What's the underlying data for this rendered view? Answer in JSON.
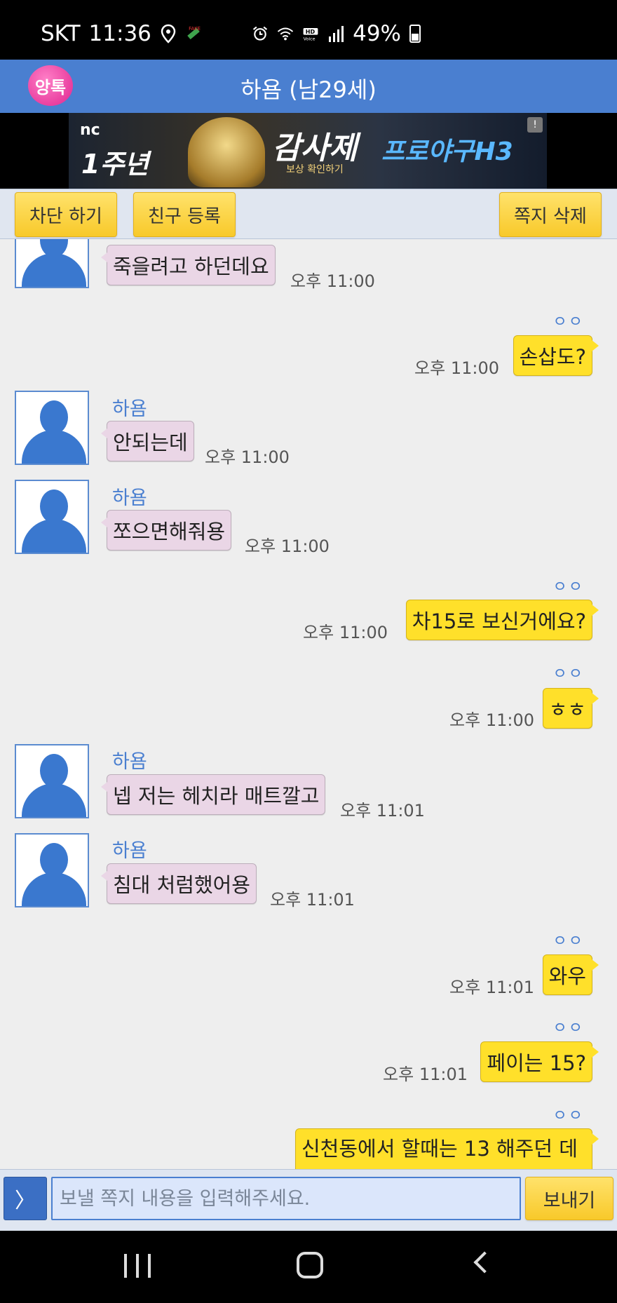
{
  "status_bar": {
    "carrier": "SKT",
    "time": "11:36",
    "battery": "49%"
  },
  "header": {
    "logo_text": "앙톡",
    "title": "하욤 (남29세)"
  },
  "ad": {
    "brand": "nc",
    "anniversary": "1주년",
    "event": "감사제",
    "subtitle": "보상 확인하기",
    "game": "프로야구H3",
    "info_mark": "!"
  },
  "actions": {
    "block": "차단 하기",
    "add_friend": "친구 등록",
    "delete": "쪽지 삭제"
  },
  "messages": [
    {
      "dir": "in",
      "sender": "",
      "text": "죽을려고 하던데요",
      "time": "오후 11:00"
    },
    {
      "dir": "out",
      "read": "ㅇㅇ",
      "text": "손삽도?",
      "time": "오후 11:00"
    },
    {
      "dir": "in",
      "sender": "하욤",
      "text": "안되는데",
      "time": "오후 11:00"
    },
    {
      "dir": "in",
      "sender": "하욤",
      "text": "쪼으면해줘용",
      "time": "오후 11:00"
    },
    {
      "dir": "out",
      "read": "ㅇㅇ",
      "text": "차15로 보신거에요?",
      "time": "오후 11:00"
    },
    {
      "dir": "out",
      "read": "ㅇㅇ",
      "text": "ㅎㅎ",
      "time": "오후 11:00"
    },
    {
      "dir": "in",
      "sender": "하욤",
      "text": "넵 저는 헤치라 매트깔고",
      "time": "오후 11:01"
    },
    {
      "dir": "in",
      "sender": "하욤",
      "text": "침대 처럼했어용",
      "time": "오후 11:01"
    },
    {
      "dir": "out",
      "read": "ㅇㅇ",
      "text": "와우",
      "time": "오후 11:01"
    },
    {
      "dir": "out",
      "read": "ㅇㅇ",
      "text": "페이는 15?",
      "time": "오후 11:01"
    },
    {
      "dir": "out",
      "read": "ㅇㅇ",
      "text": "신천동에서 할때는 13 해주던 데",
      "time": ""
    }
  ],
  "input": {
    "expand": "〉",
    "placeholder": "보낼 쪽지 내용을 입력해주세요.",
    "send": "보내기"
  }
}
